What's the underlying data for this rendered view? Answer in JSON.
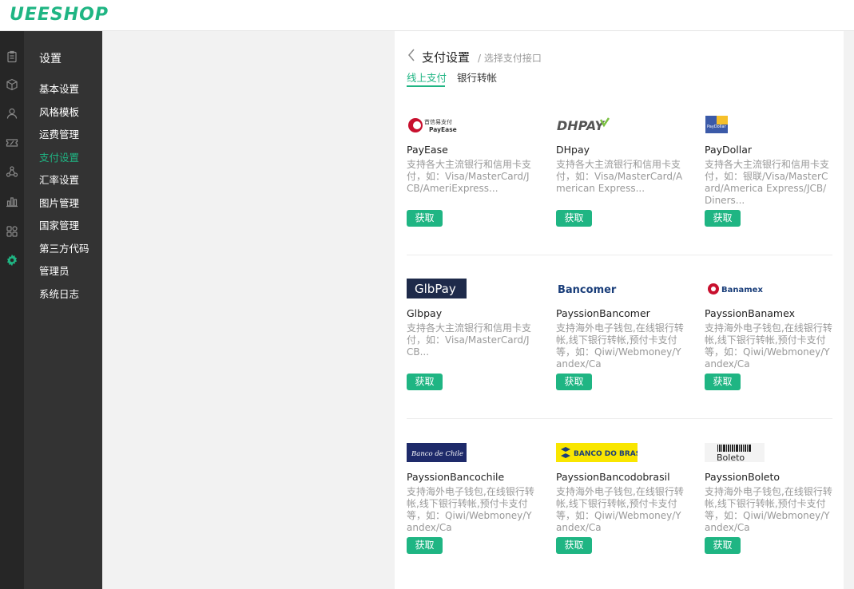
{
  "app": {
    "logo": "UEESHOP"
  },
  "rail": [
    "clipboard-icon",
    "box-icon",
    "user-icon",
    "ticket-icon",
    "nodes-icon",
    "bar-chart-icon",
    "apps-icon",
    "gear-icon"
  ],
  "menu": {
    "title": "设置",
    "items": [
      {
        "label": "基本设置"
      },
      {
        "label": "风格模板"
      },
      {
        "label": "运费管理"
      },
      {
        "label": "支付设置"
      },
      {
        "label": "汇率设置"
      },
      {
        "label": "图片管理"
      },
      {
        "label": "国家管理"
      },
      {
        "label": "第三方代码"
      },
      {
        "label": "管理员"
      },
      {
        "label": "系统日志"
      }
    ],
    "active_index": 3
  },
  "page": {
    "title": "支付设置",
    "subtitle": "/ 选择支付接口"
  },
  "tabs": [
    {
      "label": "线上支付"
    },
    {
      "label": "银行转帐"
    }
  ],
  "colors": {
    "accent": "#1fb583",
    "rail_bg": "#262626",
    "menu_bg": "#333333"
  },
  "cards": [
    {
      "name": "PayEase",
      "desc": "支持各大主流银行和信用卡支付，如：Visa/MasterCard/JCB/AmeriExpress...",
      "button": "获取",
      "logo_text": "首信易支付",
      "logo_sub": "PayEase"
    },
    {
      "name": "DHpay",
      "desc": "支持各大主流银行和信用卡支付，如：Visa/MasterCard/American Express...",
      "button": "获取",
      "logo_text": "DHPAY"
    },
    {
      "name": "PayDollar",
      "desc": "支持各大主流银行和信用卡支付，如：银联/Visa/MasterCard/America Express/JCB/Diners...",
      "button": "获取",
      "logo_text": "PayDollar"
    },
    {
      "name": "Glbpay",
      "desc": "支持各大主流银行和信用卡支付，如：Visa/MasterCard/JCB...",
      "button": "获取",
      "logo_text": "GlbPay"
    },
    {
      "name": "PayssionBancomer",
      "desc": "支持海外电子钱包,在线银行转帐,线下银行转帐,预付卡支付等，如：Qiwi/Webmoney/Yandex/Ca",
      "button": "获取",
      "logo_text": "Bancomer"
    },
    {
      "name": "PayssionBanamex",
      "desc": "支持海外电子钱包,在线银行转帐,线下银行转帐,预付卡支付等，如：Qiwi/Webmoney/Yandex/Ca",
      "button": "获取",
      "logo_text": "Banamex"
    },
    {
      "name": "PayssionBancochile",
      "desc": "支持海外电子钱包,在线银行转帐,线下银行转帐,预付卡支付等，如：Qiwi/Webmoney/Yandex/Ca",
      "button": "获取",
      "logo_text": "Banco de Chile"
    },
    {
      "name": "PayssionBancodobrasil",
      "desc": "支持海外电子钱包,在线银行转帐,线下银行转帐,预付卡支付等，如：Qiwi/Webmoney/Yandex/Ca",
      "button": "获取",
      "logo_text": "BANCO DO BRASIL"
    },
    {
      "name": "PayssionBoleto",
      "desc": "支持海外电子钱包,在线银行转帐,线下银行转帐,预付卡支付等，如：Qiwi/Webmoney/Yandex/Ca",
      "button": "获取",
      "logo_text": "Boleto"
    }
  ]
}
